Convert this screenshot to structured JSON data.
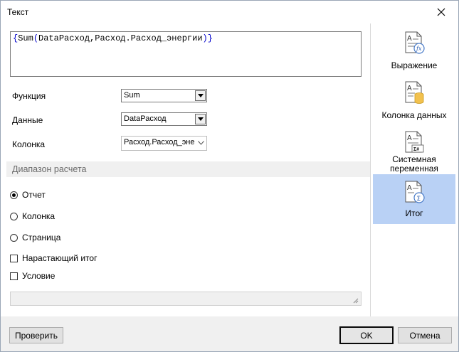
{
  "window": {
    "title": "Текст"
  },
  "expression": {
    "text": "{Sum(DataРасход,Расход.Расход_энергии)}"
  },
  "form": {
    "function_label": "Функция",
    "function_value": "Sum",
    "data_label": "Данные",
    "data_value": "DataРасход",
    "column_label": "Колонка",
    "column_value": "Расход.Расход_энергии"
  },
  "range": {
    "header": "Диапазон расчета",
    "options": [
      {
        "label": "Отчет",
        "checked": true
      },
      {
        "label": "Колонка",
        "checked": false
      },
      {
        "label": "Страница",
        "checked": false
      }
    ]
  },
  "checks": {
    "running_total": "Нарастающий итог",
    "condition": "Условие"
  },
  "sidebar": {
    "items": [
      {
        "label": "Выражение",
        "icon": "expression-fx-icon",
        "active": false
      },
      {
        "label": "Колонка данных",
        "icon": "data-column-icon",
        "active": false
      },
      {
        "label": "Системная переменная",
        "icon": "system-variable-icon",
        "active": false
      },
      {
        "label": "Итог",
        "icon": "total-sigma-icon",
        "active": true
      }
    ]
  },
  "buttons": {
    "check": "Проверить",
    "ok": "OK",
    "cancel": "Отмена"
  },
  "colors": {
    "active_sidebar": "#b9d1f5",
    "section_header_bg": "#f0f0f0",
    "brace": "#0000cc"
  }
}
